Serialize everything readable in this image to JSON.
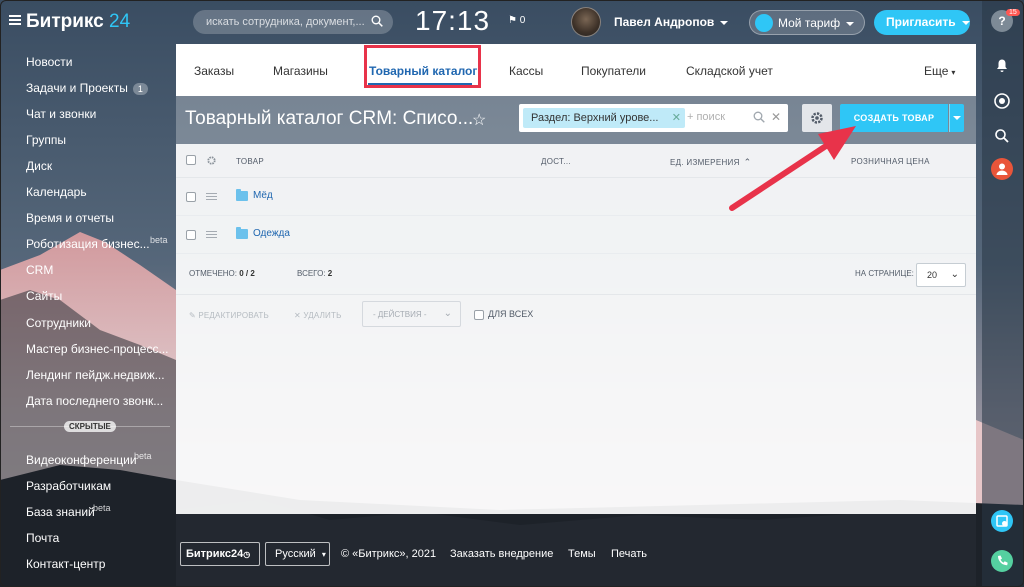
{
  "header": {
    "logo_text": "Битрикс",
    "logo_num": "24",
    "search_placeholder": "искать сотрудника, документ,...",
    "clock": "17:13",
    "flag_count": "0",
    "username": "Павел Андропов",
    "tariff_label": "Мой тариф",
    "invite_label": "Пригласить"
  },
  "sidebar": {
    "items": [
      {
        "label": "Новости"
      },
      {
        "label": "Задачи и Проекты",
        "badge": "1"
      },
      {
        "label": "Чат и звонки"
      },
      {
        "label": "Группы"
      },
      {
        "label": "Диск"
      },
      {
        "label": "Календарь"
      },
      {
        "label": "Время и отчеты"
      },
      {
        "label": "Роботизация бизнес...",
        "beta": "beta"
      },
      {
        "label": "CRM"
      },
      {
        "label": "Сайты"
      },
      {
        "label": "Сотрудники"
      },
      {
        "label": "Мастер бизнес-процесс..."
      },
      {
        "label": "Лендинг пейдж.недвиж..."
      },
      {
        "label": "Дата последнего звонк..."
      }
    ],
    "hidden_label": "СКРЫТЫЕ",
    "hidden_items": [
      {
        "label": "Видеоконференции",
        "beta": "beta"
      },
      {
        "label": "Разработчикам"
      },
      {
        "label": "База знаний",
        "beta": "beta"
      },
      {
        "label": "Почта"
      },
      {
        "label": "Контакт-центр"
      }
    ]
  },
  "rightbar": {
    "help_badge": "15"
  },
  "tabs": [
    {
      "label": "Заказы"
    },
    {
      "label": "Магазины"
    },
    {
      "label": "Товарный каталог",
      "active": true
    },
    {
      "label": "Кассы"
    },
    {
      "label": "Покупатели"
    },
    {
      "label": "Складской учет"
    },
    {
      "label": "Еще"
    }
  ],
  "toolbar": {
    "title": "Товарный каталог CRM: Списо...",
    "filter_chip": "Раздел: Верхний урове...",
    "filter_placeholder": "+ поиск",
    "create_label": "СОЗДАТЬ ТОВАР"
  },
  "grid": {
    "columns": [
      "ТОВАР",
      "ДОСТ...",
      "ЕД. ИЗМЕРЕНИЯ",
      "РОЗНИЧНАЯ ЦЕНА"
    ],
    "rows": [
      {
        "name": "Мёд"
      },
      {
        "name": "Одежда"
      }
    ],
    "selected_label": "ОТМЕЧЕНО:",
    "selected_value": "0 / 2",
    "total_label": "ВСЕГО:",
    "total_value": "2",
    "per_page_label": "НА СТРАНИЦЕ:",
    "per_page_value": "20",
    "edit_label": "РЕДАКТИРОВАТЬ",
    "delete_label": "УДАЛИТЬ",
    "actions_label": "- ДЕЙСТВИЯ -",
    "for_all_label": "ДЛЯ ВСЕХ"
  },
  "footer": {
    "logo": "Битрикс24",
    "lang": "Русский",
    "copyright": "© «Битрикс», 2021",
    "order": "Заказать внедрение",
    "themes": "Темы",
    "print": "Печать"
  },
  "colors": {
    "accent": "#2fc6f6",
    "link": "#2067b0",
    "highlight": "#e8334a"
  }
}
